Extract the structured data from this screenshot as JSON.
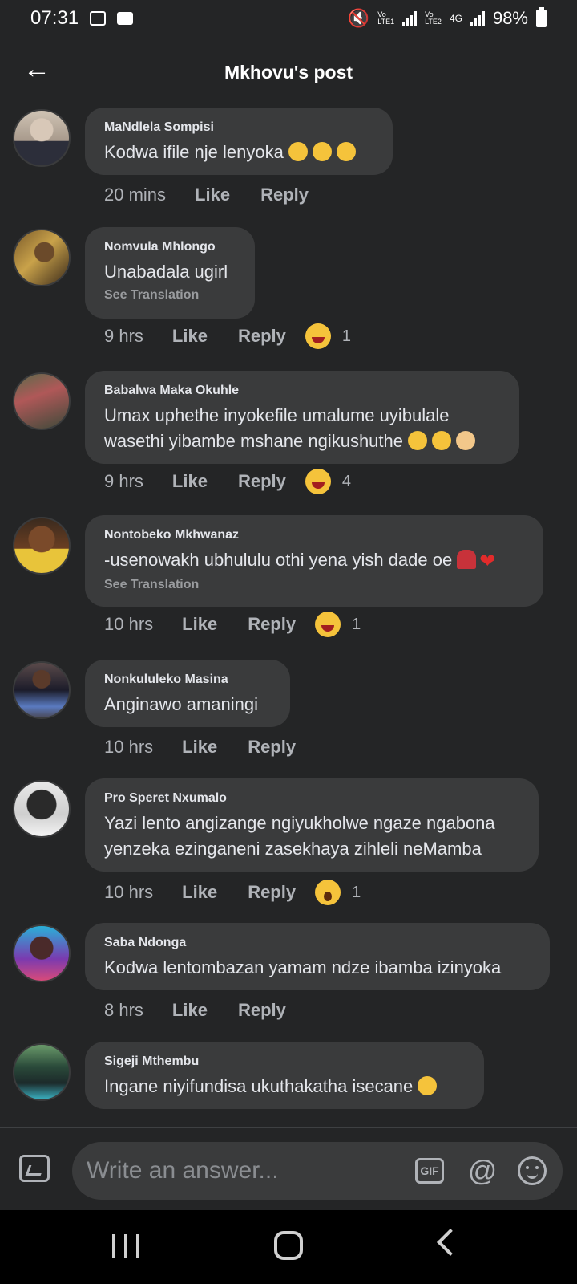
{
  "status": {
    "time": "07:31",
    "battery": "98%",
    "sim1": "Vo\nLTE1",
    "sim2": "Vo\nLTE2",
    "network": "4G"
  },
  "header": {
    "title": "Mkhovu's post"
  },
  "actions": {
    "like": "Like",
    "reply": "Reply",
    "see_translation": "See Translation"
  },
  "comments": [
    {
      "name": "MaNdlela Sompisi",
      "text": "Kodwa ifile nje lenyoka",
      "time": "20 mins",
      "reaction_count": ""
    },
    {
      "name": "Nomvula Mhlongo",
      "text": "Unabadala ugirl",
      "time": "9 hrs",
      "reaction_count": "1"
    },
    {
      "name": "Babalwa Maka Okuhle",
      "text": "Umax uphethe inyokefile umalume uyibulale wasethi yibambe mshane ngikushuthe",
      "time": "9 hrs",
      "reaction_count": "4"
    },
    {
      "name": "Nontobeko Mkhwanaz",
      "text": "-usenowakh ubhululu othi yena yish dade oe",
      "time": "10 hrs",
      "reaction_count": "1"
    },
    {
      "name": "Nonkululeko Masina",
      "text": "Anginawo amaningi",
      "time": "10 hrs",
      "reaction_count": ""
    },
    {
      "name": "Pro Speret Nxumalo",
      "text": "Yazi lento angizange ngiyukholwe ngaze ngabona yenzeka ezinganeni zasekhaya zihleli neMamba",
      "time": "10 hrs",
      "reaction_count": "1"
    },
    {
      "name": "Saba Ndonga",
      "text": "Kodwa lentombazan yamam ndze ibamba izinyoka",
      "time": "8 hrs",
      "reaction_count": ""
    },
    {
      "name": "Sigeji Mthembu",
      "text": "Ingane niyifundisa ukuthakatha isecane",
      "time": "",
      "reaction_count": ""
    }
  ],
  "composer": {
    "placeholder": "Write an answer...",
    "gif_label": "GIF",
    "at_label": "@"
  },
  "colors": {
    "background": "#242526",
    "bubble": "#3a3b3c",
    "text": "#e4e6eb",
    "muted": "#b0b3b8"
  }
}
